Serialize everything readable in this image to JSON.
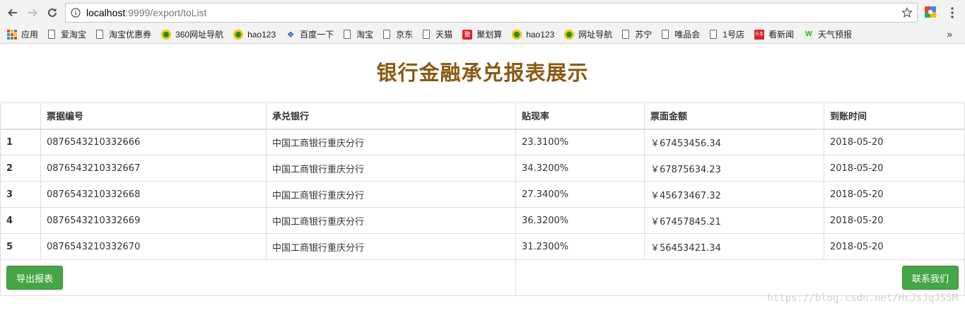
{
  "browser": {
    "url_host": "localhost",
    "url_path": ":9999/export/toList",
    "bookmarks": [
      {
        "label": "应用",
        "icon": "apps-grid-icon"
      },
      {
        "label": "爱淘宝",
        "icon": "page-icon"
      },
      {
        "label": "淘宝优惠券",
        "icon": "page-icon"
      },
      {
        "label": "360网址导航",
        "icon": "hao-icon"
      },
      {
        "label": "hao123",
        "icon": "hao-icon"
      },
      {
        "label": "百度一下",
        "icon": "baidu-paw-icon"
      },
      {
        "label": "淘宝",
        "icon": "page-icon"
      },
      {
        "label": "京东",
        "icon": "page-icon"
      },
      {
        "label": "天猫",
        "icon": "page-icon"
      },
      {
        "label": "聚划算",
        "icon": "ju-icon"
      },
      {
        "label": "hao123",
        "icon": "hao-icon"
      },
      {
        "label": "网址导航",
        "icon": "hao-icon"
      },
      {
        "label": "苏宁",
        "icon": "page-icon"
      },
      {
        "label": "唯品会",
        "icon": "page-icon"
      },
      {
        "label": "1号店",
        "icon": "page-icon"
      },
      {
        "label": "看新闻",
        "icon": "news-icon"
      },
      {
        "label": "天气预报",
        "icon": "weather-w-icon"
      }
    ],
    "more_label": "»"
  },
  "page": {
    "title": "银行金融承兑报表展示"
  },
  "table": {
    "headers": [
      "",
      "票据编号",
      "承兑银行",
      "贴现率",
      "票面金额",
      "到账时间"
    ],
    "rows": [
      [
        "1",
        "0876543210332666",
        "中国工商银行重庆分行",
        "23.3100%",
        "￥67453456.34",
        "2018-05-20"
      ],
      [
        "2",
        "0876543210332667",
        "中国工商银行重庆分行",
        "34.3200%",
        "￥67875634.23",
        "2018-05-20"
      ],
      [
        "3",
        "0876543210332668",
        "中国工商银行重庆分行",
        "27.3400%",
        "￥45673467.32",
        "2018-05-20"
      ],
      [
        "4",
        "0876543210332669",
        "中国工商银行重庆分行",
        "36.3200%",
        "￥67457845.21",
        "2018-05-20"
      ],
      [
        "5",
        "0876543210332670",
        "中国工商银行重庆分行",
        "31.2300%",
        "￥56453421.34",
        "2018-05-20"
      ]
    ]
  },
  "actions": {
    "export_label": "导出报表",
    "contact_label": "联系我们"
  },
  "watermark": "https://blog.csdn.net/HcJsJqJSSM",
  "colors": {
    "title": "#8b5a13",
    "button_green": "#46a646"
  }
}
